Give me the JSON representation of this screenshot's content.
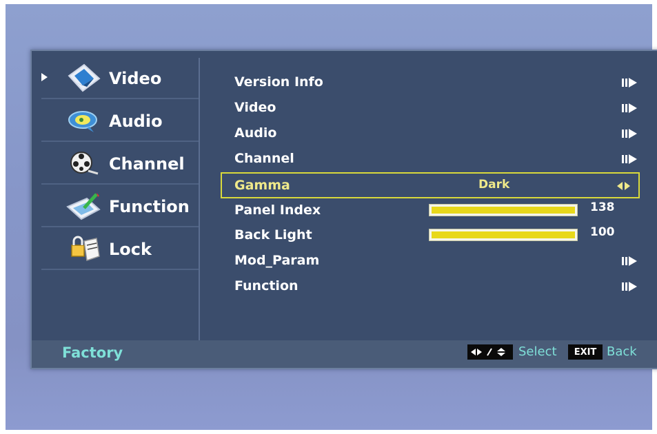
{
  "menu": {
    "footer_title": "Factory",
    "nav": [
      {
        "label": "Video",
        "icon": "video-icon",
        "active": true
      },
      {
        "label": "Audio",
        "icon": "audio-icon"
      },
      {
        "label": "Channel",
        "icon": "channel-icon"
      },
      {
        "label": "Function",
        "icon": "function-icon"
      },
      {
        "label": "Lock",
        "icon": "lock-icon"
      }
    ],
    "items": [
      {
        "label": "Version Info",
        "type": "submenu"
      },
      {
        "label": "Video",
        "type": "submenu"
      },
      {
        "label": "Audio",
        "type": "submenu"
      },
      {
        "label": "Channel",
        "type": "submenu"
      },
      {
        "label": "Gamma",
        "type": "option",
        "value": "Dark",
        "selected": true
      },
      {
        "label": "Panel Index",
        "type": "slider",
        "value": "138",
        "fill_fraction": 1.0
      },
      {
        "label": "Back Light",
        "type": "slider",
        "value": "100",
        "fill_fraction": 1.0
      },
      {
        "label": "Mod_Param",
        "type": "submenu"
      },
      {
        "label": "Function",
        "type": "submenu"
      }
    ],
    "hints": {
      "select_label": "Select",
      "exit_key": "EXIT",
      "back_label": "Back"
    }
  },
  "colors": {
    "panel": "#3b4d6c",
    "highlight": "#d9d93b",
    "accent_text": "#7fe0d8",
    "bar_fill": "#e8d81a"
  }
}
